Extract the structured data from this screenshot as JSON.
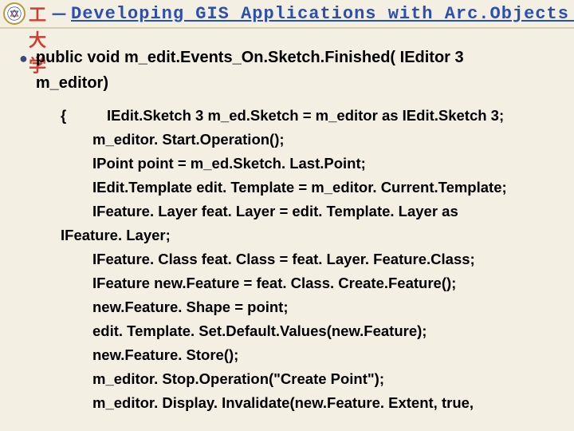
{
  "header": {
    "university": "西理工大学",
    "separator": "－",
    "title": "Developing GIS Applications with Arc.Objects using C#. NE"
  },
  "signature": {
    "line1": "public void m_edit.Events_On.Sketch.Finished( IEditor 3",
    "line2": "m_editor)"
  },
  "code": {
    "brace": "{",
    "l0": "IEdit.Sketch 3 m_ed.Sketch = m_editor as IEdit.Sketch 3;",
    "l1": "m_editor. Start.Operation();",
    "l2": "IPoint point = m_ed.Sketch. Last.Point;",
    "l3": "IEdit.Template edit. Template = m_editor. Current.Template;",
    "l4a": "IFeature. Layer feat. Layer = edit. Template. Layer as",
    "l4b": "IFeature. Layer;",
    "l5": "IFeature. Class feat. Class = feat. Layer. Feature.Class;",
    "l6": "IFeature new.Feature = feat. Class. Create.Feature();",
    "l7": "new.Feature. Shape = point;",
    "l8": "edit. Template. Set.Default.Values(new.Feature);",
    "l9": "new.Feature. Store();",
    "l10": "m_editor. Stop.Operation(\"Create Point\");",
    "l11": "m_editor. Display. Invalidate(new.Feature. Extent, true,"
  }
}
